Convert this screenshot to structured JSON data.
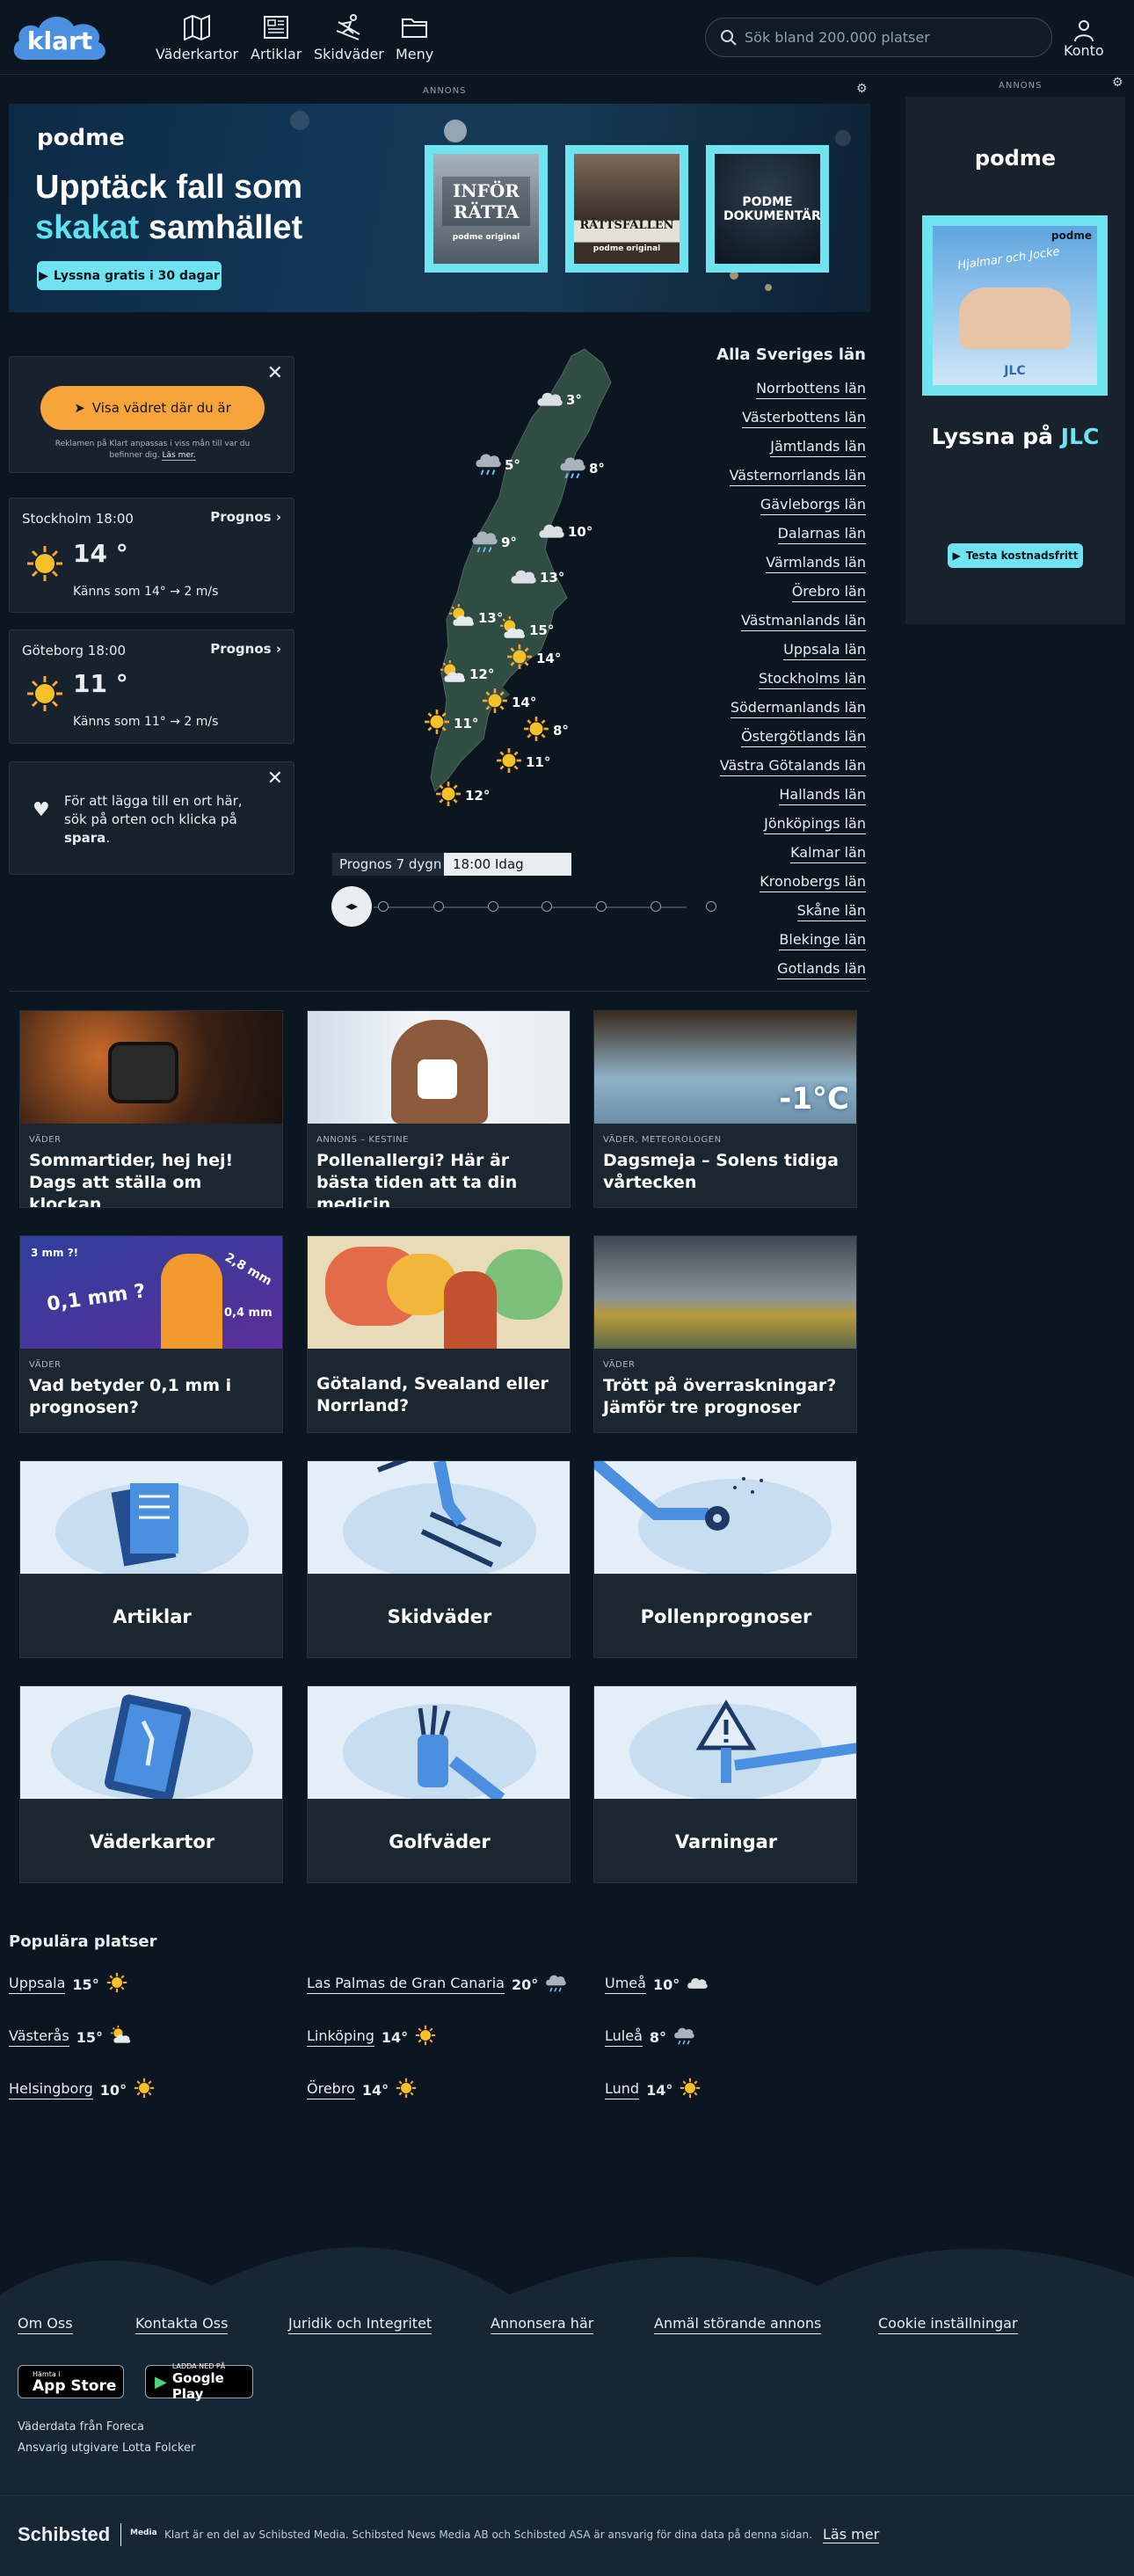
{
  "header": {
    "logo": "klart",
    "nav": [
      {
        "label": "Väderkartor",
        "icon": "map-icon"
      },
      {
        "label": "Artiklar",
        "icon": "newspaper-icon"
      },
      {
        "label": "Skidväder",
        "icon": "skier-icon"
      },
      {
        "label": "Meny",
        "icon": "folder-icon"
      }
    ],
    "search_placeholder": "Sök bland 200.000 platser",
    "account_label": "Konto"
  },
  "ads": {
    "label": "ANNONS",
    "banner": {
      "brand": "podme",
      "headline_1": "Upptäck fall som",
      "headline_2a": "skakat",
      "headline_2b": " samhället",
      "cta": "Lyssna gratis i 30 dagar",
      "posters": [
        {
          "title": "INFÖR RÄTTA",
          "sub": "podme original"
        },
        {
          "title": "RÄTTSFALLEN",
          "sub": "podme original"
        },
        {
          "title": "PODME DOKUMENTÄR",
          "sub": ""
        }
      ]
    },
    "side": {
      "brand": "podme",
      "poster_brand": "podme",
      "poster_title": "Hjalmar och Jocke",
      "poster_badge": "JLC",
      "text_a": "Lyssna på ",
      "text_b": "JLC",
      "cta": "Testa kostnadsfritt"
    }
  },
  "location_panel": {
    "button": "Visa vädret där du är",
    "note_a": "Reklamen på Klart anpassas i viss mån till var du",
    "note_b": "befinner dig.",
    "note_link": "Läs mer."
  },
  "forecasts": [
    {
      "title": "Stockholm 18:00",
      "link": "Prognos",
      "temp": "14 °",
      "feels": "Känns som 14°",
      "wind": "2 m/s"
    },
    {
      "title": "Göteborg 18:00",
      "link": "Prognos",
      "temp": "11 °",
      "feels": "Känns som 11°",
      "wind": "2 m/s"
    }
  ],
  "favorites_tip": {
    "text_a": "För att lägga till en ort här,",
    "text_b": "sök på orten och klicka på",
    "text_c": "spara",
    "text_d": "."
  },
  "map": {
    "labels": [
      {
        "t": "3°",
        "icon": "cloud"
      },
      {
        "t": "5°",
        "icon": "rain"
      },
      {
        "t": "8°",
        "icon": "rain"
      },
      {
        "t": "9°",
        "icon": "rain"
      },
      {
        "t": "10°",
        "icon": "cloud"
      },
      {
        "t": "13°",
        "icon": "cloud"
      },
      {
        "t": "13°",
        "icon": "partly"
      },
      {
        "t": "15°",
        "icon": "partly"
      },
      {
        "t": "12°",
        "icon": "partly"
      },
      {
        "t": "14°",
        "icon": "sun"
      },
      {
        "t": "14°",
        "icon": "sun"
      },
      {
        "t": "11°",
        "icon": "sun"
      },
      {
        "t": "8°",
        "icon": "sun"
      },
      {
        "t": "11°",
        "icon": "sun"
      },
      {
        "t": "12°",
        "icon": "sun"
      }
    ]
  },
  "lan": {
    "title": "Alla Sveriges län",
    "items": [
      "Norrbottens län",
      "Västerbottens län",
      "Jämtlands län",
      "Västernorrlands län",
      "Gävleborgs län",
      "Dalarnas län",
      "Värmlands län",
      "Örebro län",
      "Västmanlands län",
      "Uppsala län",
      "Stockholms län",
      "Södermanlands län",
      "Östergötlands län",
      "Västra Götalands län",
      "Hallands län",
      "Jönköpings län",
      "Kalmar län",
      "Kronobergs län",
      "Skåne län",
      "Blekinge län",
      "Gotlands län"
    ]
  },
  "prognos": {
    "label": "Prognos 7 dygn",
    "time": "18:00 Idag"
  },
  "articles": [
    {
      "tag": "VÄDER",
      "title": "Sommartider, hej hej! Dags att ställa om klockan"
    },
    {
      "tag": "ANNONS – KESTINE",
      "title": "Pollenallergi? Här är bästa tiden att ta din medicin"
    },
    {
      "tag": "VÄDER, METEOROLOGEN",
      "title": "Dagsmeja – Solens tidiga vårtecken",
      "overlay": "-1°C"
    },
    {
      "tag": "VÄDER",
      "title": "Vad betyder 0,1 mm i prognosen?",
      "overlay_a": "0,1 mm ?",
      "overlay_b": "3 mm ?!",
      "overlay_c": "2,8 mm",
      "overlay_d": "0,4 mm"
    },
    {
      "tag": "",
      "title": "Götaland, Svealand eller Norrland?"
    },
    {
      "tag": "VÄDER",
      "title": "Trött på överraskningar? Jämför tre prognoser"
    }
  ],
  "categories": [
    "Artiklar",
    "Skidväder",
    "Pollenprognoser",
    "Väderkartor",
    "Golfväder",
    "Varningar"
  ],
  "popular": {
    "title": "Populära platser",
    "items": [
      {
        "name": "Uppsala",
        "temp": "15°",
        "icon": "sun"
      },
      {
        "name": "Las Palmas de Gran Canaria",
        "temp": "20°",
        "icon": "rain"
      },
      {
        "name": "Umeå",
        "temp": "10°",
        "icon": "cloud"
      },
      {
        "name": "Västerås",
        "temp": "15°",
        "icon": "partly"
      },
      {
        "name": "Linköping",
        "temp": "14°",
        "icon": "sun"
      },
      {
        "name": "Luleå",
        "temp": "8°",
        "icon": "rain"
      },
      {
        "name": "Helsingborg",
        "temp": "10°",
        "icon": "sun"
      },
      {
        "name": "Örebro",
        "temp": "14°",
        "icon": "sun"
      },
      {
        "name": "Lund",
        "temp": "14°",
        "icon": "sun"
      }
    ]
  },
  "footer": {
    "links": [
      "Om Oss",
      "Kontakta Oss",
      "Juridik och Integritet",
      "Annonsera här",
      "Anmäl störande annons",
      "Cookie inställningar"
    ],
    "appstore_small": "Hämta i",
    "appstore_big": "App Store",
    "google_small": "LADDA NED PÅ",
    "google_big": "Google Play",
    "data_source": "Väderdata från Foreca",
    "publisher": "Ansvarig utgivare Lotta Folcker",
    "schibsted": "Schibsted",
    "media": "Media",
    "disclaimer": "Klart är en del av Schibsted Media. Schibsted News Media AB och Schibsted ASA är ansvarig för dina data på denna sidan.",
    "read_more": "Läs mer"
  },
  "colors": {
    "bg": "#0b1620",
    "panel": "#17222c",
    "accent_orange": "#f7a53a",
    "accent_cyan": "#6fe3ef",
    "logo_blue": "#3b82d6"
  }
}
